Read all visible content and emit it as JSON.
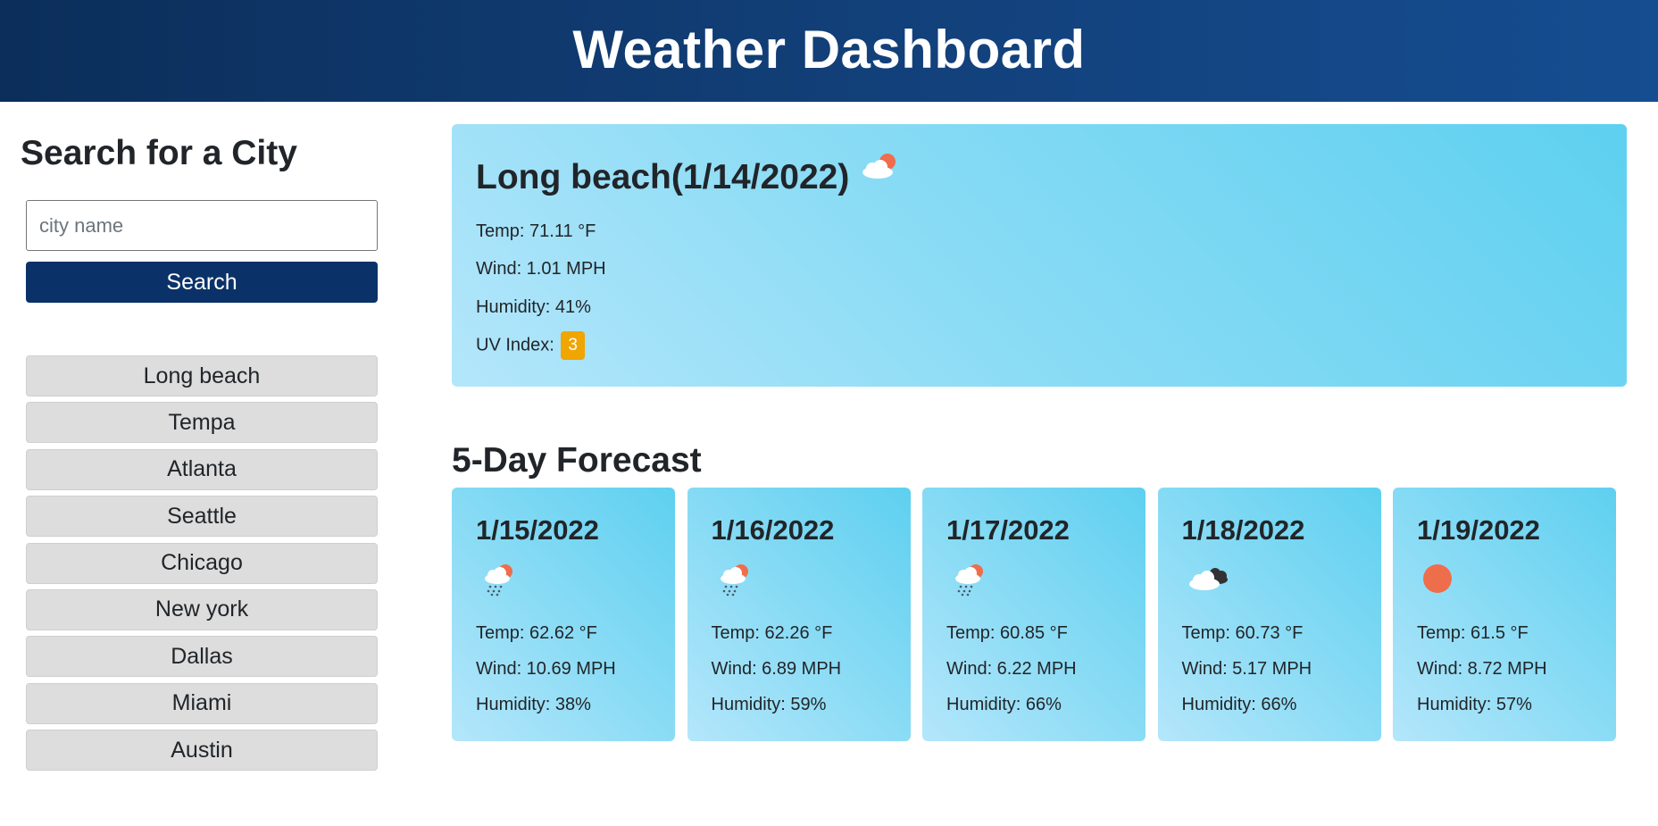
{
  "header": {
    "title": "Weather Dashboard"
  },
  "sidebar": {
    "heading": "Search for a City",
    "search_placeholder": "city name",
    "search_value": "",
    "search_button": "Search",
    "history": [
      "Long beach",
      "Tempa",
      "Atlanta",
      "Seattle",
      "Chicago",
      "New york",
      "Dallas",
      "Miami",
      "Austin"
    ]
  },
  "current": {
    "title": "Long beach(1/14/2022)",
    "icon": "partly-cloudy-day-icon",
    "temp": "Temp: 71.11 °F",
    "wind": "Wind: 1.01 MPH",
    "humidity": "Humidity: 41%",
    "uv_label": "UV Index:",
    "uv_value": "3",
    "uv_color": "#f0a500"
  },
  "forecast": {
    "heading": "5-Day Forecast",
    "days": [
      {
        "date": "1/15/2022",
        "icon": "rain-sun-icon",
        "temp": "Temp: 62.62 °F",
        "wind": "Wind: 10.69 MPH",
        "humidity": "Humidity: 38%"
      },
      {
        "date": "1/16/2022",
        "icon": "rain-sun-icon",
        "temp": "Temp: 62.26 °F",
        "wind": "Wind: 6.89 MPH",
        "humidity": "Humidity: 59%"
      },
      {
        "date": "1/17/2022",
        "icon": "rain-sun-icon",
        "temp": "Temp: 60.85 °F",
        "wind": "Wind: 6.22 MPH",
        "humidity": "Humidity: 66%"
      },
      {
        "date": "1/18/2022",
        "icon": "broken-clouds-icon",
        "temp": "Temp: 60.73 °F",
        "wind": "Wind: 5.17 MPH",
        "humidity": "Humidity: 66%"
      },
      {
        "date": "1/19/2022",
        "icon": "clear-sun-icon",
        "temp": "Temp: 61.5 °F",
        "wind": "Wind: 8.72 MPH",
        "humidity": "Humidity: 57%"
      }
    ]
  },
  "colors": {
    "header": "#123f78",
    "search_button": "#0b3268",
    "history_button": "#dddddd",
    "card_light": "#b4e6fb",
    "card_dark": "#5ed0f0",
    "sun": "#ee6e4c"
  }
}
